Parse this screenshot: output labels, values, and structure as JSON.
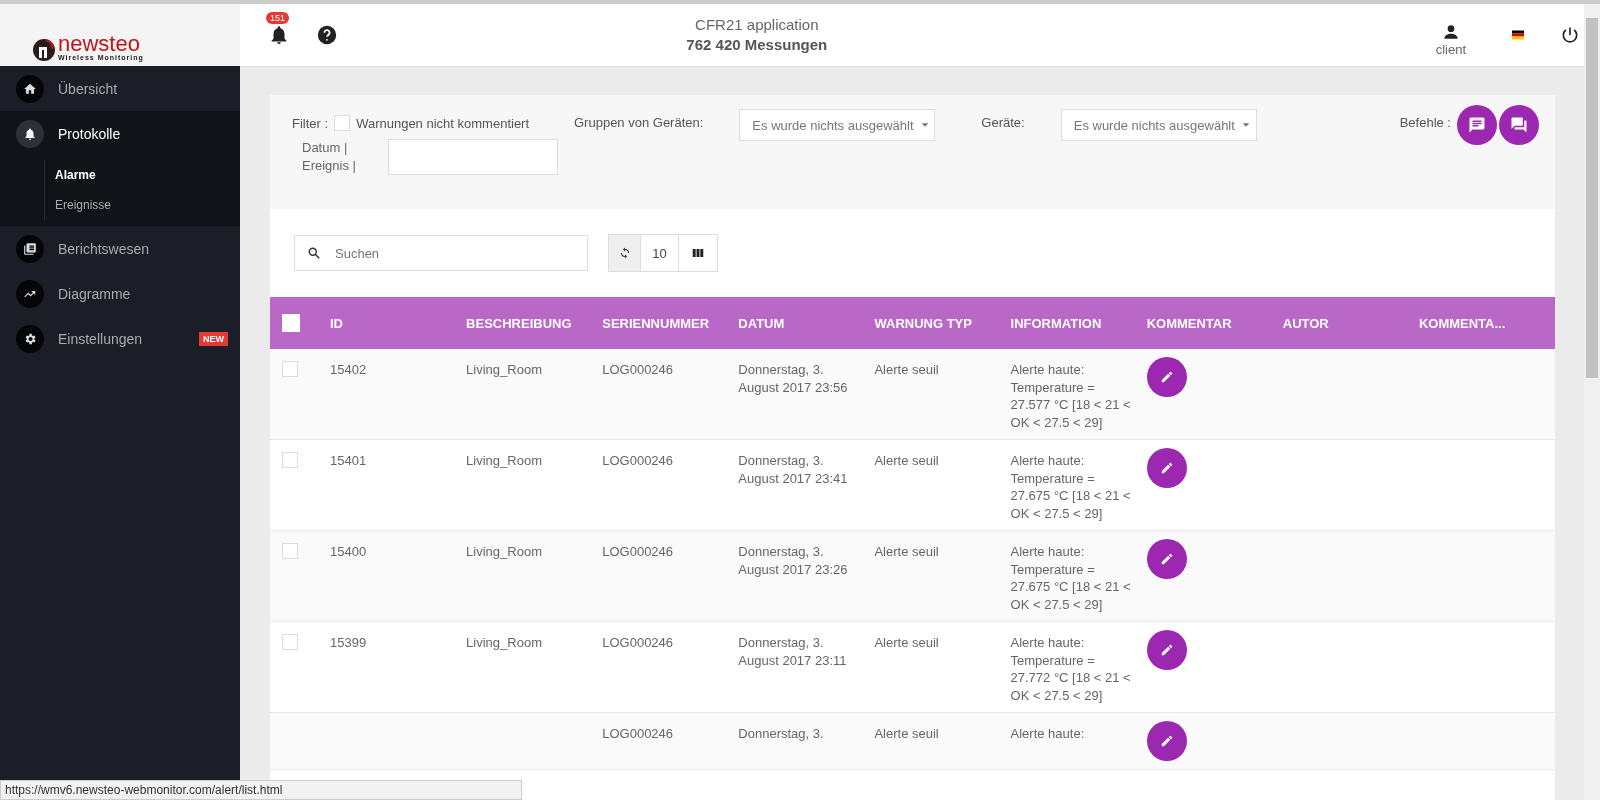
{
  "logo": {
    "name": "newsteo",
    "tagline": "Wireless Monitoring"
  },
  "header": {
    "notifications": "151",
    "title": "CFR21 application",
    "subtitle": "762 420 Messungen",
    "user": "client"
  },
  "sidebar": {
    "items": [
      {
        "label": "Übersicht",
        "selected": false
      },
      {
        "label": "Protokolle",
        "selected": true,
        "expanded": true,
        "children": [
          {
            "label": "Alarme",
            "selected": true
          },
          {
            "label": "Ereignisse",
            "selected": false
          }
        ]
      },
      {
        "label": "Berichtswesen",
        "selected": false
      },
      {
        "label": "Diagramme",
        "selected": false
      },
      {
        "label": "Einstellungen",
        "selected": false,
        "badge": "NEW"
      }
    ]
  },
  "filter": {
    "label": "Filter :",
    "checkbox_label": "Warnungen nicht kommentiert",
    "checked": false,
    "groups_label": "Gruppen von Geräten:",
    "groups_value": "Es wurde nichts ausgewählt",
    "devices_label": "Geräte:",
    "devices_value": "Es wurde nichts ausgewählt",
    "commands_label": "Befehle :",
    "date_label": "Datum | Ereignis |"
  },
  "toolbar": {
    "search_placeholder": "Suchen",
    "page_size": "10"
  },
  "table": {
    "all_checked": false,
    "columns": [
      "ID",
      "BESCHREIBUNG",
      "SERIENNUMMER",
      "DATUM",
      "WARNUNG TYP",
      "INFORMATION",
      "KOMMENTAR",
      "AUTOR",
      "KOMMENTA..."
    ],
    "rows": [
      {
        "checked": false,
        "id": "15402",
        "description": "Living_Room",
        "serial": "LOG000246",
        "date": "Donnerstag, 3. August 2017 23:56",
        "type": "Alerte seuil",
        "info": "Alerte haute: Temperature = 27.577 °C [18 < 21 < OK < 27.5 < 29]"
      },
      {
        "checked": false,
        "id": "15401",
        "description": "Living_Room",
        "serial": "LOG000246",
        "date": "Donnerstag, 3. August 2017 23:41",
        "type": "Alerte seuil",
        "info": "Alerte haute: Temperature = 27.675 °C [18 < 21 < OK < 27.5 < 29]"
      },
      {
        "checked": false,
        "id": "15400",
        "description": "Living_Room",
        "serial": "LOG000246",
        "date": "Donnerstag, 3. August 2017 23:26",
        "type": "Alerte seuil",
        "info": "Alerte haute: Temperature = 27.675 °C [18 < 21 < OK < 27.5 < 29]"
      },
      {
        "checked": false,
        "id": "15399",
        "description": "Living_Room",
        "serial": "LOG000246",
        "date": "Donnerstag, 3. August 2017 23:11",
        "type": "Alerte seuil",
        "info": "Alerte haute: Temperature = 27.772 °C [18 < 21 < OK < 27.5 < 29]"
      },
      {
        "serial": "LOG000246",
        "date": "Donnerstag, 3.",
        "type": "Alerte seuil",
        "info": "Alerte haute:"
      }
    ]
  },
  "status_url": "https://wmv6.newsteo-webmonitor.com/alert/list.html"
}
